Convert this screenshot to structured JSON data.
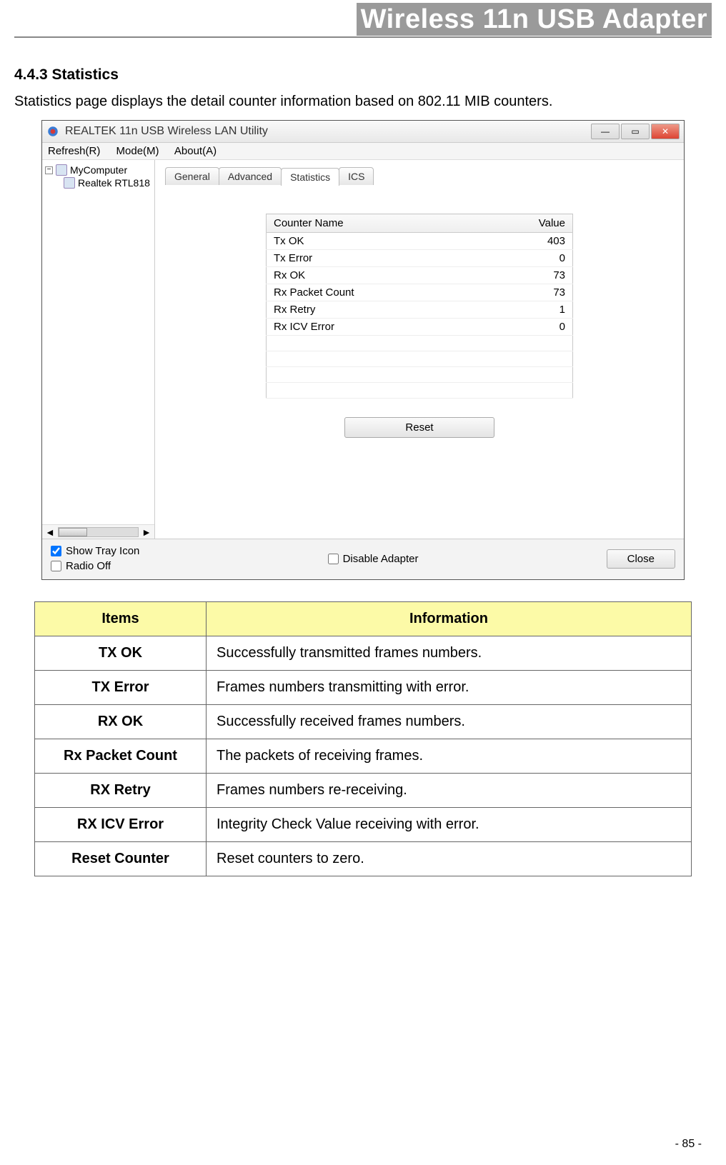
{
  "header": {
    "title": "Wireless 11n USB Adapter"
  },
  "section": {
    "heading": "4.4.3    Statistics",
    "intro": "Statistics page displays the detail counter information based on 802.11 MIB counters."
  },
  "app_window": {
    "title": "REALTEK 11n USB Wireless LAN Utility",
    "menu": {
      "refresh": "Refresh(R)",
      "mode": "Mode(M)",
      "about": "About(A)"
    },
    "tree": {
      "root": "MyComputer",
      "child": "Realtek RTL818",
      "expander": "−"
    },
    "tabs": {
      "general": "General",
      "advanced": "Advanced",
      "statistics": "Statistics",
      "ics": "ICS"
    },
    "table": {
      "col_name": "Counter Name",
      "col_value": "Value",
      "rows": [
        {
          "name": "Tx OK",
          "value": "403"
        },
        {
          "name": "Tx Error",
          "value": "0"
        },
        {
          "name": "Rx OK",
          "value": "73"
        },
        {
          "name": "Rx Packet Count",
          "value": "73"
        },
        {
          "name": "Rx Retry",
          "value": "1"
        },
        {
          "name": "Rx ICV Error",
          "value": "0"
        }
      ]
    },
    "reset_label": "Reset",
    "bottom": {
      "show_tray": "Show Tray Icon",
      "radio_off": "Radio Off",
      "disable_adapter": "Disable Adapter",
      "close": "Close"
    },
    "scroll_arrow_left": "◄",
    "scroll_arrow_right": "►"
  },
  "info_table": {
    "col_items": "Items",
    "col_info": "Information",
    "rows": [
      {
        "item": "TX OK",
        "info": "Successfully transmitted frames numbers."
      },
      {
        "item": "TX Error",
        "info": "Frames numbers transmitting with error."
      },
      {
        "item": "RX OK",
        "info": "Successfully received frames numbers."
      },
      {
        "item": "Rx Packet Count",
        "info": "The packets of receiving frames."
      },
      {
        "item": "RX Retry",
        "info": "Frames numbers re-receiving."
      },
      {
        "item": "RX ICV Error",
        "info": "Integrity Check Value receiving with error."
      },
      {
        "item": "Reset Counter",
        "info": "Reset counters to zero."
      }
    ]
  },
  "page_number": "- 85 -"
}
